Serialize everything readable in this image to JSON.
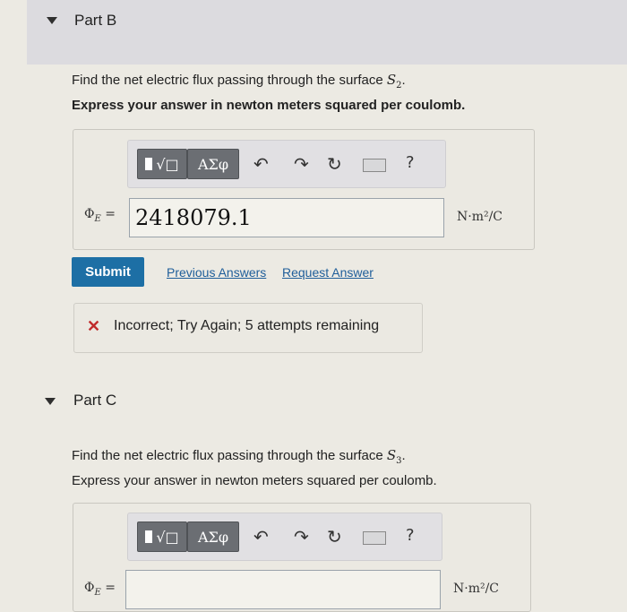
{
  "part_b": {
    "title": "Part B",
    "question_line1_prefix": "Find the net electric flux passing through the surface ",
    "surface": "S",
    "surface_sub": "2",
    "question_line2": "Express your answer in newton meters squared per coulomb.",
    "toolbar": {
      "template_label": "√□",
      "greek_label": "ΑΣφ",
      "help_label": "?"
    },
    "symbol": "Φ",
    "symbol_sub": "E",
    "equals": "=",
    "answer_value": "2418079.1",
    "units": "N·m²/C",
    "submit_label": "Submit",
    "previous_answers_label": "Previous Answers",
    "request_answer_label": "Request Answer",
    "feedback": "Incorrect; Try Again; 5 attempts remaining"
  },
  "part_c": {
    "title": "Part C",
    "question_line1_prefix": "Find the net electric flux passing through the surface ",
    "surface": "S",
    "surface_sub": "3",
    "question_line2": "Express your answer in newton meters squared per coulomb.",
    "toolbar": {
      "template_label": "√□",
      "greek_label": "ΑΣφ",
      "help_label": "?"
    },
    "symbol": "Φ",
    "symbol_sub": "E",
    "equals": "=",
    "answer_value": "",
    "units": "N·m²/C"
  }
}
